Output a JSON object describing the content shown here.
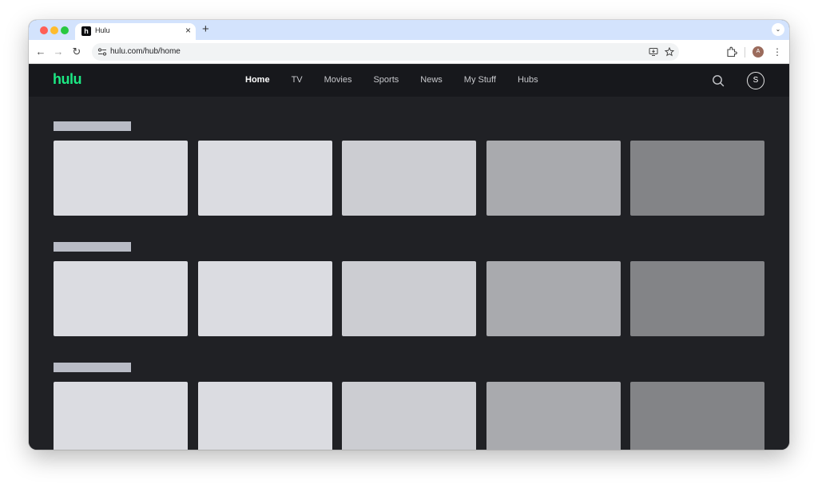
{
  "browser": {
    "tab_title": "Hulu",
    "tab_favicon_letter": "h",
    "tab_close_label": "×",
    "new_tab_label": "+",
    "tab_menu_label": "⌄",
    "url": "hulu.com/hub/home",
    "profile_initial": "A",
    "menu_label": "⋮",
    "back_label": "←",
    "forward_label": "→",
    "reload_label": "↻"
  },
  "header": {
    "logo": "hulu",
    "nav": [
      "Home",
      "TV",
      "Movies",
      "Sports",
      "News",
      "My Stuff",
      "Hubs"
    ],
    "active_nav": "Home",
    "profile_initial": "S"
  },
  "colors": {
    "brand": "#1ce783",
    "tile_shades": [
      "#dbdce1",
      "#dbdce1",
      "#cccdd2",
      "#a9aaae",
      "#838487"
    ],
    "placeholder_title": "#b9bcc6"
  },
  "rows": [
    {
      "tiles": 5
    },
    {
      "tiles": 5
    },
    {
      "tiles": 5
    }
  ]
}
